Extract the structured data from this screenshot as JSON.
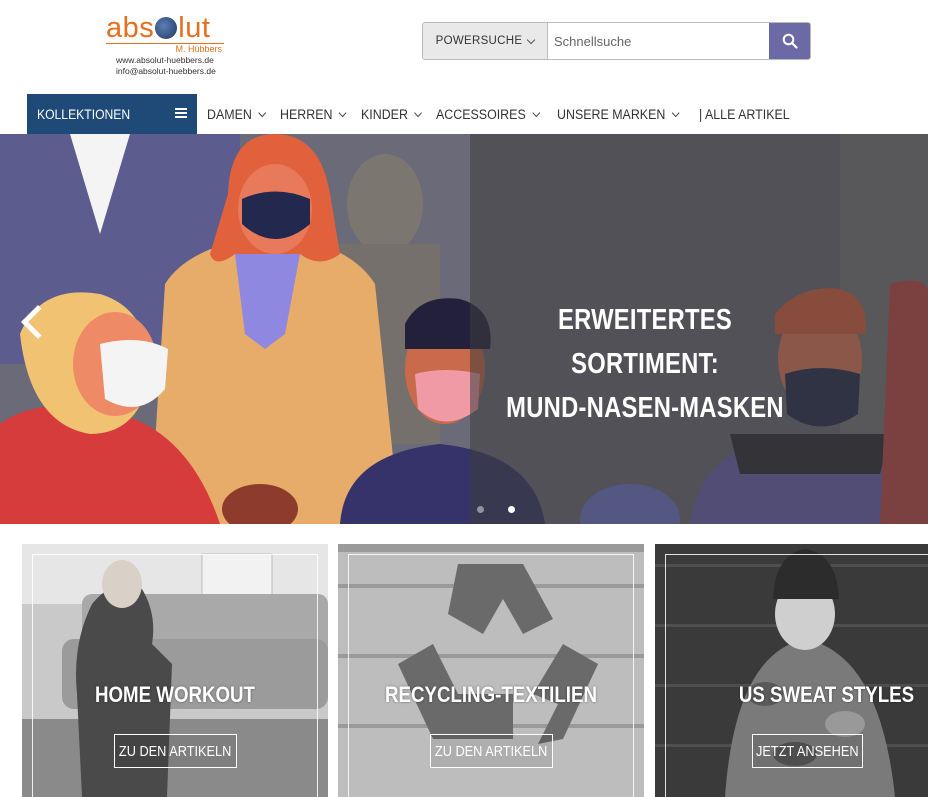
{
  "header": {
    "logo": {
      "word": "absolut",
      "owner": "M. Hübbers",
      "url": "www.absolut-huebbers.de",
      "email": "info@absolut-huebbers.de"
    },
    "search": {
      "scope_label": "POWERSUCHE",
      "placeholder": "Schnellsuche",
      "icon": "search-icon"
    }
  },
  "nav": {
    "collections_label": "KOLLEKTIONEN",
    "items": [
      {
        "label": "DAMEN",
        "has_dropdown": true
      },
      {
        "label": "HERREN",
        "has_dropdown": true
      },
      {
        "label": "KINDER",
        "has_dropdown": true
      },
      {
        "label": "ACCESSOIRES",
        "has_dropdown": true
      },
      {
        "label": "UNSERE MARKEN",
        "has_dropdown": true
      },
      {
        "label": "| ALLE ARTIKEL",
        "has_dropdown": false
      }
    ]
  },
  "hero": {
    "line1": "ERWEITERTES SORTIMENT:",
    "line2": "MUND-NASEN-MASKEN",
    "slide_count": 2,
    "active_slide": 2
  },
  "tiles": [
    {
      "title": "HOME WORKOUT",
      "button": "ZU DEN ARTIKELN"
    },
    {
      "title": "RECYCLING-TEXTILIEN",
      "button": "ZU DEN ARTIKELN"
    },
    {
      "title": "US SWEAT STYLES",
      "button": "JETZT ANSEHEN"
    }
  ],
  "colors": {
    "nav_active": "#1f4a78",
    "search_button": "#6b6aa6",
    "logo_orange": "#e46f1e"
  }
}
